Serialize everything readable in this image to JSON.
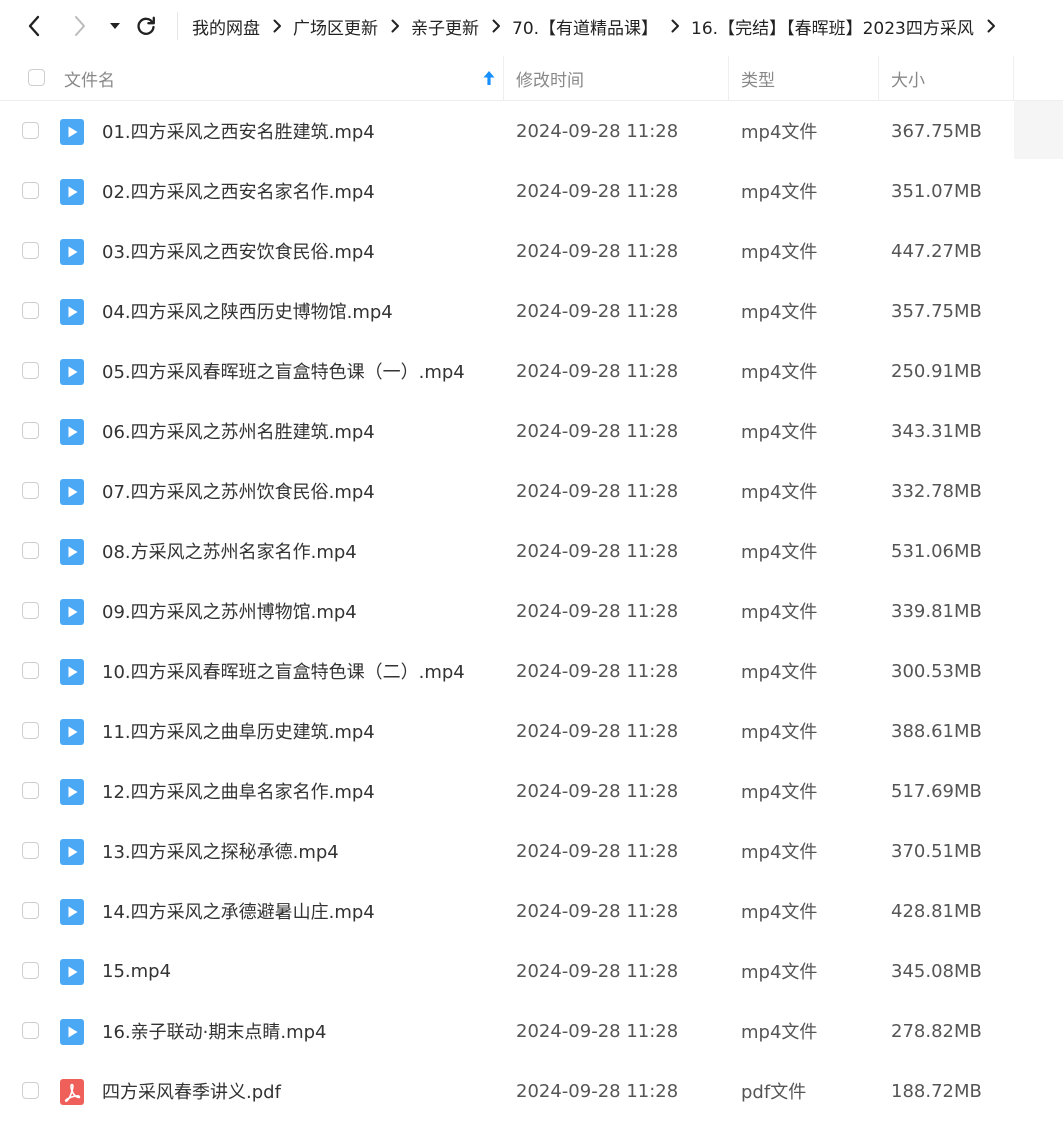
{
  "nav": {
    "back_icon": "chevron-left-icon",
    "forward_icon": "chevron-right-icon",
    "dropdown_icon": "caret-down-icon",
    "refresh_icon": "refresh-icon"
  },
  "breadcrumb": [
    "我的网盘",
    "广场区更新",
    "亲子更新",
    "70.【有道精品课】",
    "16.【完结】【春晖班】2023四方采风"
  ],
  "columns": {
    "name": "文件名",
    "modified": "修改时间",
    "type": "类型",
    "size": "大小",
    "sort_icon": "sort-ascending-icon"
  },
  "colors": {
    "video_icon": "#4aa8f5",
    "pdf_icon": "#f0605a",
    "sort_arrow": "#1890ff"
  },
  "files": [
    {
      "name": "01.四方采风之西安名胜建筑.mp4",
      "date": "2024-09-28 11:28",
      "type": "mp4文件",
      "size": "367.75MB",
      "icon": "video-file-icon"
    },
    {
      "name": "02.四方采风之西安名家名作.mp4",
      "date": "2024-09-28 11:28",
      "type": "mp4文件",
      "size": "351.07MB",
      "icon": "video-file-icon"
    },
    {
      "name": "03.四方采风之西安饮食民俗.mp4",
      "date": "2024-09-28 11:28",
      "type": "mp4文件",
      "size": "447.27MB",
      "icon": "video-file-icon"
    },
    {
      "name": "04.四方采风之陕西历史博物馆.mp4",
      "date": "2024-09-28 11:28",
      "type": "mp4文件",
      "size": "357.75MB",
      "icon": "video-file-icon"
    },
    {
      "name": "05.四方采风春晖班之盲盒特色课（一）.mp4",
      "date": "2024-09-28 11:28",
      "type": "mp4文件",
      "size": "250.91MB",
      "icon": "video-file-icon"
    },
    {
      "name": "06.四方采风之苏州名胜建筑.mp4",
      "date": "2024-09-28 11:28",
      "type": "mp4文件",
      "size": "343.31MB",
      "icon": "video-file-icon"
    },
    {
      "name": "07.四方采风之苏州饮食民俗.mp4",
      "date": "2024-09-28 11:28",
      "type": "mp4文件",
      "size": "332.78MB",
      "icon": "video-file-icon"
    },
    {
      "name": "08.方采风之苏州名家名作.mp4",
      "date": "2024-09-28 11:28",
      "type": "mp4文件",
      "size": "531.06MB",
      "icon": "video-file-icon"
    },
    {
      "name": "09.四方采风之苏州博物馆.mp4",
      "date": "2024-09-28 11:28",
      "type": "mp4文件",
      "size": "339.81MB",
      "icon": "video-file-icon"
    },
    {
      "name": "10.四方采风春晖班之盲盒特色课（二）.mp4",
      "date": "2024-09-28 11:28",
      "type": "mp4文件",
      "size": "300.53MB",
      "icon": "video-file-icon"
    },
    {
      "name": "11.四方采风之曲阜历史建筑.mp4",
      "date": "2024-09-28 11:28",
      "type": "mp4文件",
      "size": "388.61MB",
      "icon": "video-file-icon"
    },
    {
      "name": "12.四方采风之曲阜名家名作.mp4",
      "date": "2024-09-28 11:28",
      "type": "mp4文件",
      "size": "517.69MB",
      "icon": "video-file-icon"
    },
    {
      "name": "13.四方采风之探秘承德.mp4",
      "date": "2024-09-28 11:28",
      "type": "mp4文件",
      "size": "370.51MB",
      "icon": "video-file-icon"
    },
    {
      "name": "14.四方采风之承德避暑山庄.mp4",
      "date": "2024-09-28 11:28",
      "type": "mp4文件",
      "size": "428.81MB",
      "icon": "video-file-icon"
    },
    {
      "name": "15.mp4",
      "date": "2024-09-28 11:28",
      "type": "mp4文件",
      "size": "345.08MB",
      "icon": "video-file-icon"
    },
    {
      "name": "16.亲子联动·期末点睛.mp4",
      "date": "2024-09-28 11:28",
      "type": "mp4文件",
      "size": "278.82MB",
      "icon": "video-file-icon"
    },
    {
      "name": "四方采风春季讲义.pdf",
      "date": "2024-09-28 11:28",
      "type": "pdf文件",
      "size": "188.72MB",
      "icon": "pdf-file-icon"
    }
  ]
}
